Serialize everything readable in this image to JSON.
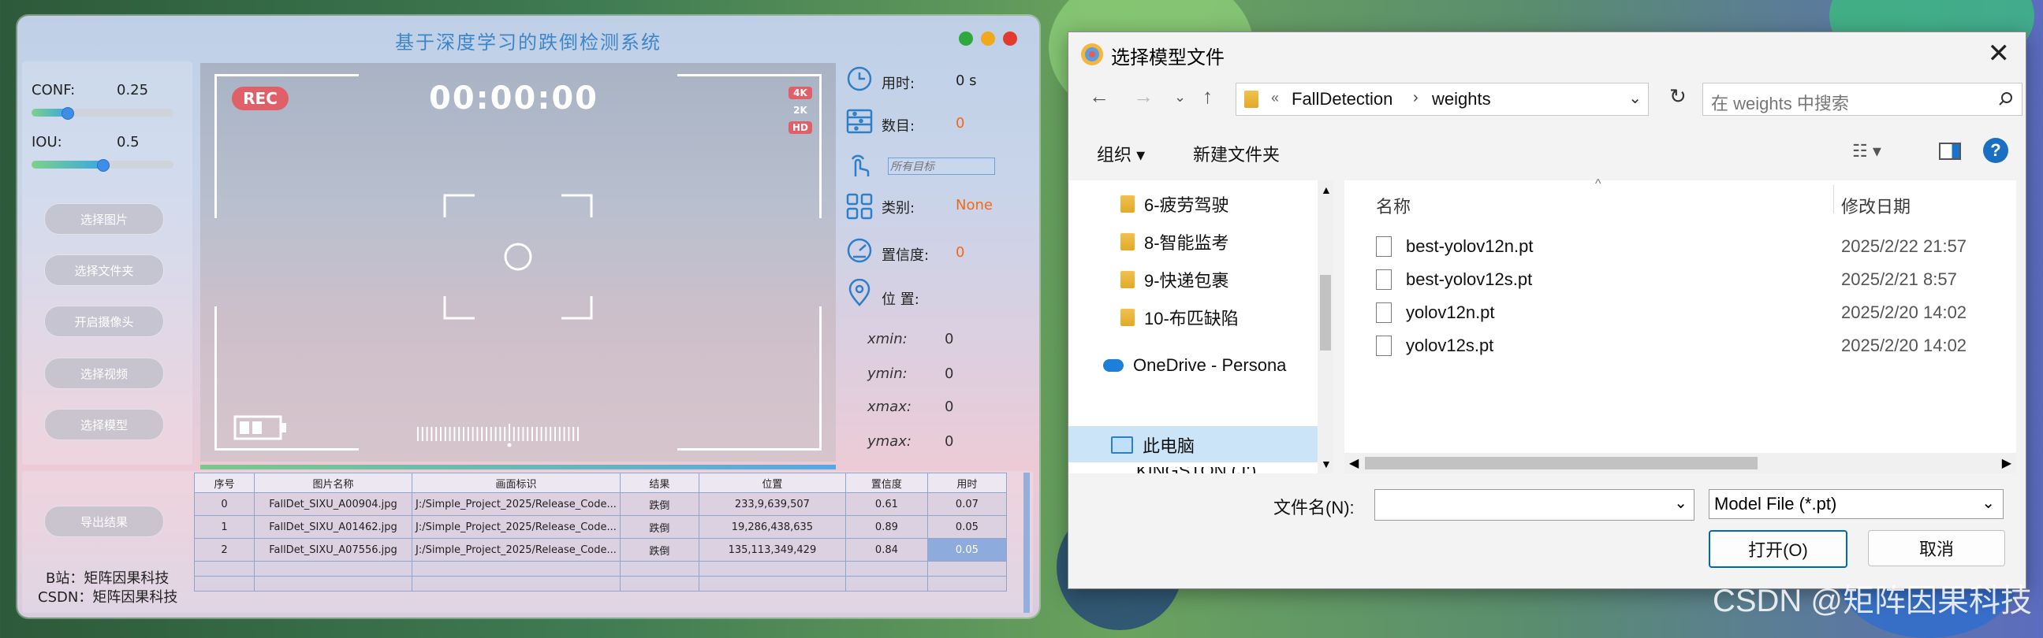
{
  "app": {
    "title": "基于深度学习的跌倒检测系统",
    "conf_label": "CONF:",
    "conf_value": "0.25",
    "conf_fraction": 0.25,
    "iou_label": "IOU:",
    "iou_value": "0.5",
    "iou_fraction": 0.5,
    "buttons": [
      "选择图片",
      "选择文件夹",
      "开启摄像头",
      "选择视频",
      "选择模型"
    ],
    "export_button": "导出结果",
    "credits": [
      "B站：矩阵因果科技",
      "CSDN：矩阵因果科技"
    ],
    "viewport": {
      "rec": "REC",
      "timer": "00:00:00",
      "res_badges": [
        "4K",
        "2K",
        "HD"
      ]
    },
    "info": {
      "time_label": "用时:",
      "time_value": "0 s",
      "count_label": "数目:",
      "count_value": "0",
      "target_placeholder": "所有目标",
      "class_label": "类别:",
      "class_value": "None",
      "conf_label": "置信度:",
      "conf_value": "0",
      "pos_label": "位 置:",
      "coords": [
        {
          "label": "xmin:",
          "value": "0"
        },
        {
          "label": "ymin:",
          "value": "0"
        },
        {
          "label": "xmax:",
          "value": "0"
        },
        {
          "label": "ymax:",
          "value": "0"
        }
      ]
    },
    "table": {
      "headers": [
        "序号",
        "图片名称",
        "画面标识",
        "结果",
        "位置",
        "置信度",
        "用时"
      ],
      "rows": [
        [
          "0",
          "FallDet_SIXU_A00904.jpg",
          "J:/Simple_Project_2025/Release_Code...",
          "跌倒",
          "233,9,639,507",
          "0.61",
          "0.07"
        ],
        [
          "1",
          "FallDet_SIXU_A01462.jpg",
          "J:/Simple_Project_2025/Release_Code...",
          "跌倒",
          "19,286,438,635",
          "0.89",
          "0.05"
        ],
        [
          "2",
          "FallDet_SIXU_A07556.jpg",
          "J:/Simple_Project_2025/Release_Code...",
          "跌倒",
          "135,113,349,429",
          "0.84",
          "0.05"
        ]
      ]
    }
  },
  "dialog": {
    "title": "选择模型文件",
    "breadcrumb": [
      "«",
      "FallDetection",
      "weights"
    ],
    "search_placeholder": "在 weights 中搜索",
    "organize": "组织 ▾",
    "new_folder": "新建文件夹",
    "nav_items": [
      "6-疲劳驾驶",
      "8-智能监考",
      "9-快递包裹",
      "10-布匹缺陷"
    ],
    "onedrive": "OneDrive - Persona",
    "this_pc": "此电脑",
    "kingston": "KINGSTON (J:)",
    "col_name": "名称",
    "col_date": "修改日期",
    "files": [
      {
        "name": "best-yolov12n.pt",
        "date": "2025/2/22 21:57"
      },
      {
        "name": "best-yolov12s.pt",
        "date": "2025/2/21 8:57"
      },
      {
        "name": "yolov12n.pt",
        "date": "2025/2/20 14:02"
      },
      {
        "name": "yolov12s.pt",
        "date": "2025/2/20 14:02"
      }
    ],
    "filename_label": "文件名(N):",
    "filter": "Model File (*.pt)",
    "open_button": "打开(O)",
    "cancel_button": "取消"
  },
  "watermark": "CSDN @矩阵因果科技",
  "colors": {
    "accent_blue": "#3d86c9",
    "rec_red": "#e0606a",
    "value_orange": "#ee6a1b",
    "primary_button_border": "#0067c0"
  }
}
